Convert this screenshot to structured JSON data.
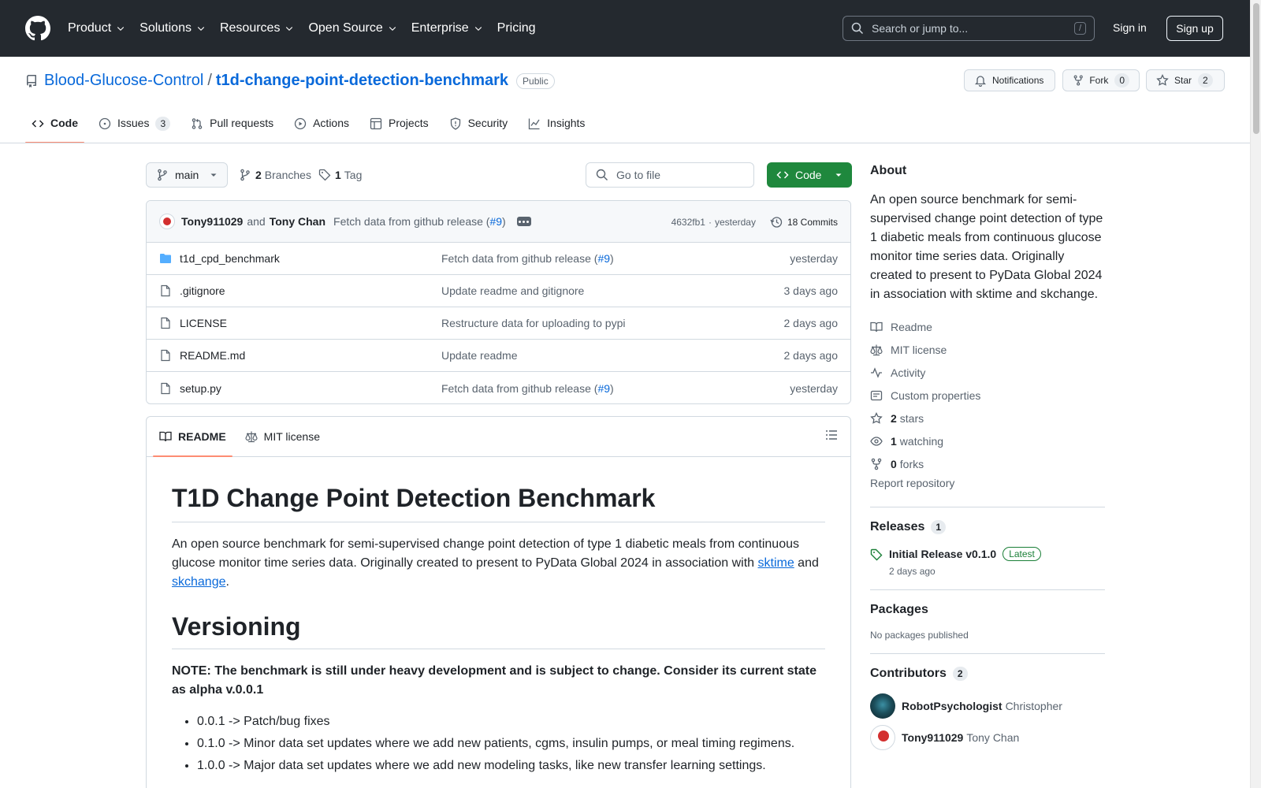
{
  "header": {
    "nav": [
      "Product",
      "Solutions",
      "Resources",
      "Open Source",
      "Enterprise",
      "Pricing"
    ],
    "search_placeholder": "Search or jump to...",
    "search_shortcut": "/",
    "sign_in": "Sign in",
    "sign_up": "Sign up"
  },
  "repo": {
    "owner": "Blood-Glucose-Control",
    "separator": "/",
    "name": "t1d-change-point-detection-benchmark",
    "visibility": "Public",
    "notifications_label": "Notifications",
    "fork_label": "Fork",
    "fork_count": "0",
    "star_label": "Star",
    "star_count": "2"
  },
  "tabs": [
    {
      "label": "Code",
      "active": true
    },
    {
      "label": "Issues",
      "count": "3"
    },
    {
      "label": "Pull requests"
    },
    {
      "label": "Actions"
    },
    {
      "label": "Projects"
    },
    {
      "label": "Security"
    },
    {
      "label": "Insights"
    }
  ],
  "branch_bar": {
    "branch": "main",
    "branches_count": "2",
    "branches_label": "Branches",
    "tags_count": "1",
    "tags_label": "Tag",
    "goto_file": "Go to file",
    "code_button": "Code"
  },
  "latest_commit": {
    "author1": "Tony911029",
    "and": "and",
    "author2": "Tony Chan",
    "message": "Fetch data from github release (",
    "pr": "#9",
    "message_end": ")",
    "hash": "4632fb1",
    "dot": "·",
    "time": "yesterday",
    "commits_label": "18 Commits"
  },
  "files": [
    {
      "name": "t1d_cpd_benchmark",
      "type": "dir",
      "msg": "Fetch data from github release (",
      "pr": "#9",
      "msg_end": ")",
      "age": "yesterday"
    },
    {
      "name": ".gitignore",
      "type": "file",
      "msg": "Update readme and gitignore",
      "pr": "",
      "msg_end": "",
      "age": "3 days ago"
    },
    {
      "name": "LICENSE",
      "type": "file",
      "msg": "Restructure data for uploading to pypi",
      "pr": "",
      "msg_end": "",
      "age": "2 days ago"
    },
    {
      "name": "README.md",
      "type": "file",
      "msg": "Update readme",
      "pr": "",
      "msg_end": "",
      "age": "2 days ago"
    },
    {
      "name": "setup.py",
      "type": "file",
      "msg": "Fetch data from github release (",
      "pr": "#9",
      "msg_end": ")",
      "age": "yesterday"
    }
  ],
  "readme": {
    "tab_readme": "README",
    "tab_license": "MIT license",
    "h1": "T1D Change Point Detection Benchmark",
    "p1_start": "An open source benchmark for semi-supervised change point detection of type 1 diabetic meals from continuous glucose monitor time series data. Originally created to present to PyData Global 2024 in association with ",
    "link_sktime": "sktime",
    "p1_and": " and ",
    "link_skchange": "skchange",
    "p1_end": ".",
    "h2": "Versioning",
    "note": "NOTE: The benchmark is still under heavy development and is subject to change. Consider its current state as alpha v.0.0.1",
    "list": [
      "0.0.1 -> Patch/bug fixes",
      "0.1.0 -> Minor data set updates where we add new patients, cgms, insulin pumps, or meal timing regimens.",
      "1.0.0 -> Major data set updates where we add new modeling tasks, like new transfer learning settings."
    ]
  },
  "sidebar": {
    "about_title": "About",
    "description": "An open source benchmark for semi-supervised change point detection of type 1 diabetic meals from continuous glucose monitor time series data. Originally created to present to PyData Global 2024 in association with sktime and skchange.",
    "links": [
      {
        "icon": "book-icon",
        "bold": "",
        "label": "Readme"
      },
      {
        "icon": "scale-icon",
        "bold": "",
        "label": "MIT license"
      },
      {
        "icon": "pulse-icon",
        "bold": "",
        "label": "Activity"
      },
      {
        "icon": "note-icon",
        "bold": "",
        "label": "Custom properties"
      },
      {
        "icon": "star-icon",
        "bold": "2",
        "label": "stars"
      },
      {
        "icon": "eye-icon",
        "bold": "1",
        "label": "watching"
      },
      {
        "icon": "fork-icon",
        "bold": "0",
        "label": "forks"
      }
    ],
    "report": "Report repository",
    "releases_title": "Releases",
    "releases_count": "1",
    "release_name": "Initial Release v0.1.0",
    "release_badge": "Latest",
    "release_date": "2 days ago",
    "packages_title": "Packages",
    "packages_text": "No packages published",
    "contributors_title": "Contributors",
    "contributors_count": "2",
    "contributors": [
      {
        "login": "RobotPsychologist",
        "name": "Christopher"
      },
      {
        "login": "Tony911029",
        "name": "Tony Chan"
      }
    ]
  }
}
